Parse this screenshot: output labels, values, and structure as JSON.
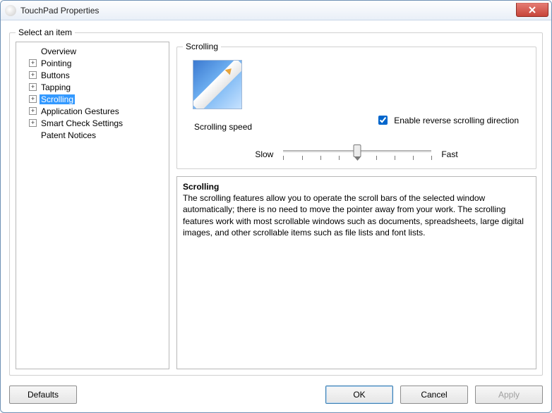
{
  "window": {
    "title": "TouchPad Properties"
  },
  "group": {
    "legend": "Select an item"
  },
  "tree": {
    "items": [
      {
        "label": "Overview",
        "expander": "",
        "selected": false
      },
      {
        "label": "Pointing",
        "expander": "+",
        "selected": false
      },
      {
        "label": "Buttons",
        "expander": "+",
        "selected": false
      },
      {
        "label": "Tapping",
        "expander": "+",
        "selected": false
      },
      {
        "label": "Scrolling",
        "expander": "+",
        "selected": true
      },
      {
        "label": "Application Gestures",
        "expander": "+",
        "selected": false
      },
      {
        "label": "Smart Check Settings",
        "expander": "+",
        "selected": false
      },
      {
        "label": "Patent Notices",
        "expander": "",
        "selected": false
      }
    ]
  },
  "scrolling": {
    "legend": "Scrolling",
    "speed_label": "Scrolling speed",
    "checkbox_label": "Enable reverse scrolling direction",
    "checkbox_checked": true,
    "slider": {
      "slow_label": "Slow",
      "fast_label": "Fast",
      "min": 0,
      "max": 8,
      "value": 4,
      "ticks": 9
    }
  },
  "description": {
    "title": "Scrolling",
    "body": "The scrolling features allow you to operate the scroll bars of the selected window automatically; there is no need to move the pointer away from your work. The scrolling features work with most scrollable windows such as documents, spreadsheets, large digital images, and other scrollable items such as file lists and font lists."
  },
  "buttons": {
    "defaults": "Defaults",
    "ok": "OK",
    "cancel": "Cancel",
    "apply": "Apply",
    "apply_enabled": false
  }
}
